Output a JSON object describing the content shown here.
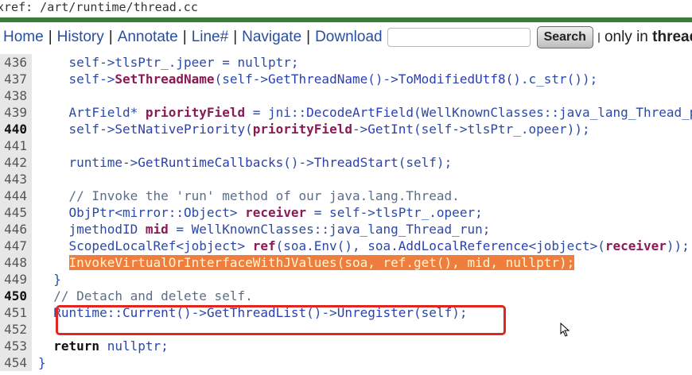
{
  "header": {
    "xref_path": "xref: /art/runtime/thread.cc"
  },
  "nav": {
    "home": "Home",
    "history": "History",
    "annotate": "Annotate",
    "line_hash": "Line#",
    "navigate": "Navigate",
    "download": "Download",
    "separator": "|",
    "search_value": "",
    "search_button": "Search",
    "only_in_prefix": "only in",
    "only_in_file": "thread.cc"
  },
  "code": {
    "lines": [
      {
        "num": "436",
        "bold": false,
        "tokens": [
          [
            "",
            "    self->tlsPtr_.jpeer = nullptr;"
          ]
        ]
      },
      {
        "num": "437",
        "bold": false,
        "tokens": [
          [
            "",
            "    self->"
          ],
          [
            "b",
            "SetThreadName"
          ],
          [
            "",
            "(self->"
          ],
          [
            "fn",
            "GetThreadName"
          ],
          [
            "",
            "()->"
          ],
          [
            "fn",
            "ToModifiedUtf8"
          ],
          [
            "",
            "().c_str());"
          ]
        ]
      },
      {
        "num": "438",
        "bold": false,
        "tokens": [
          [
            "",
            ""
          ]
        ]
      },
      {
        "num": "439",
        "bold": false,
        "tokens": [
          [
            "",
            "    ArtField* "
          ],
          [
            "b",
            "priorityField"
          ],
          [
            "",
            " = jni::"
          ],
          [
            "fn",
            "DecodeArtField"
          ],
          [
            "",
            "(WellKnownClasses::java_lang_Thread_priority);"
          ]
        ]
      },
      {
        "num": "440",
        "bold": true,
        "tokens": [
          [
            "",
            "    self->"
          ],
          [
            "fn",
            "SetNativePriority"
          ],
          [
            "",
            "("
          ],
          [
            "b",
            "priorityField"
          ],
          [
            "",
            "->"
          ],
          [
            "fn",
            "GetInt"
          ],
          [
            "",
            "(self->tlsPtr_.opeer));"
          ]
        ]
      },
      {
        "num": "441",
        "bold": false,
        "tokens": [
          [
            "",
            ""
          ]
        ]
      },
      {
        "num": "442",
        "bold": false,
        "tokens": [
          [
            "",
            "    runtime->"
          ],
          [
            "fn",
            "GetRuntimeCallbacks"
          ],
          [
            "",
            "()->"
          ],
          [
            "fn",
            "ThreadStart"
          ],
          [
            "",
            "(self);"
          ]
        ]
      },
      {
        "num": "443",
        "bold": false,
        "tokens": [
          [
            "",
            ""
          ]
        ]
      },
      {
        "num": "444",
        "bold": false,
        "tokens": [
          [
            "cm",
            "    // Invoke the 'run' method of our java.lang.Thread."
          ]
        ]
      },
      {
        "num": "445",
        "bold": false,
        "tokens": [
          [
            "",
            "    ObjPtr<mirror::Object> "
          ],
          [
            "b",
            "receiver"
          ],
          [
            "",
            " = self->tlsPtr_.opeer;"
          ]
        ]
      },
      {
        "num": "446",
        "bold": false,
        "tokens": [
          [
            "",
            "    jmethodID "
          ],
          [
            "b",
            "mid"
          ],
          [
            "",
            " = WellKnownClasses::java_lang_Thread_run;"
          ]
        ]
      },
      {
        "num": "447",
        "bold": false,
        "tokens": [
          [
            "",
            "    ScopedLocalRef<jobject> "
          ],
          [
            "b",
            "ref"
          ],
          [
            "",
            "(soa.Env(), soa."
          ],
          [
            "fn",
            "AddLocalReference"
          ],
          [
            "",
            "<jobject>("
          ],
          [
            "b",
            "receiver"
          ],
          [
            "",
            "));"
          ]
        ]
      },
      {
        "num": "448",
        "bold": false,
        "tokens": [
          [
            "",
            "    "
          ],
          [
            "hl",
            "InvokeVirtualOrInterfaceWithJValues(soa, ref.get(), mid, nullptr);"
          ]
        ]
      },
      {
        "num": "449",
        "bold": false,
        "tokens": [
          [
            "",
            "  }"
          ]
        ]
      },
      {
        "num": "450",
        "bold": true,
        "tokens": [
          [
            "cm",
            "  // Detach and delete self."
          ]
        ]
      },
      {
        "num": "451",
        "bold": false,
        "tokens": [
          [
            "",
            "  Runtime::"
          ],
          [
            "fn",
            "Current"
          ],
          [
            "",
            "()->"
          ],
          [
            "fn",
            "GetThreadList"
          ],
          [
            "",
            "()->"
          ],
          [
            "fn",
            "Unregister"
          ],
          [
            "",
            "(self);"
          ]
        ]
      },
      {
        "num": "452",
        "bold": false,
        "tokens": [
          [
            "",
            ""
          ]
        ]
      },
      {
        "num": "453",
        "bold": false,
        "tokens": [
          [
            "",
            "  "
          ],
          [
            "kw",
            "return"
          ],
          [
            "",
            " nullptr;"
          ]
        ]
      },
      {
        "num": "454",
        "bold": false,
        "tokens": [
          [
            "",
            "}"
          ]
        ]
      }
    ]
  },
  "highlight": {
    "line": "448",
    "box_color": "#e1261f",
    "selection_color": "#ef7e3e"
  },
  "colors": {
    "accent_rule": "#3c7a3a",
    "link": "#2a4e9e",
    "gutter": "#e7e7e7"
  }
}
